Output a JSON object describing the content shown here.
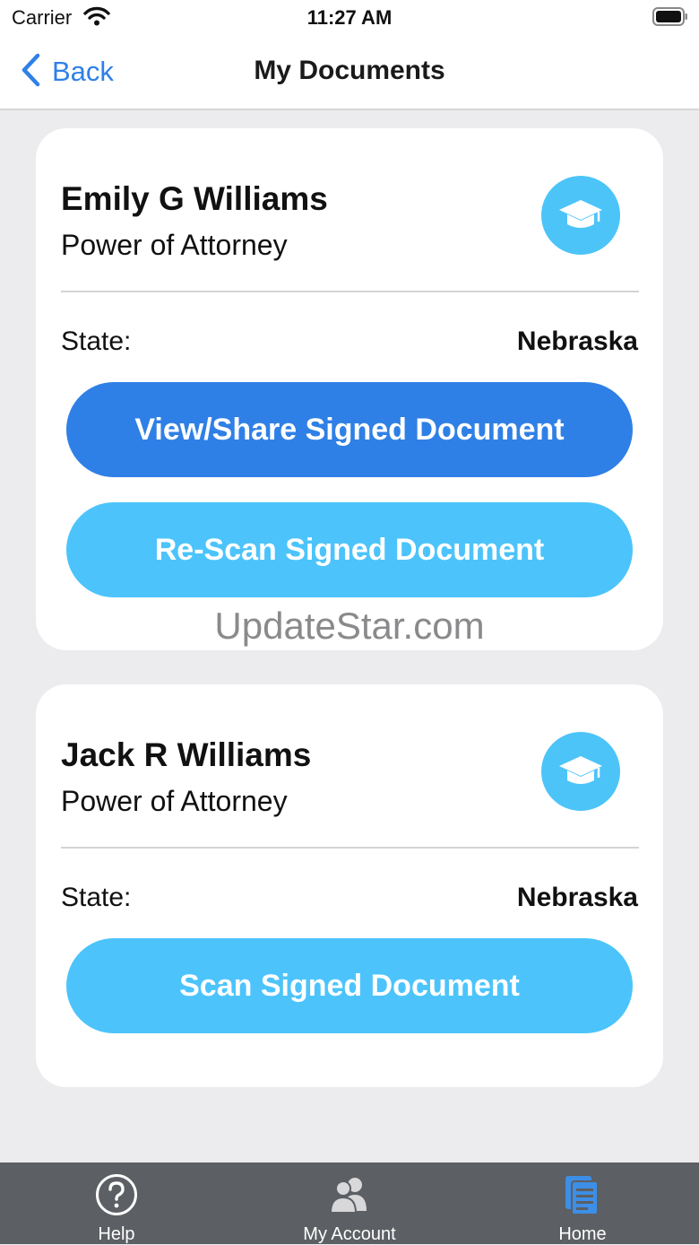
{
  "status_bar": {
    "carrier": "Carrier",
    "time": "11:27 AM"
  },
  "nav": {
    "back_label": "Back",
    "title": "My Documents"
  },
  "documents": [
    {
      "name": "Emily G Williams",
      "doc_type": "Power of Attorney",
      "state_label": "State:",
      "state_value": "Nebraska",
      "buttons": [
        "View/Share Signed Document",
        "Re-Scan Signed Document"
      ],
      "icon": "graduation-cap-icon"
    },
    {
      "name": "Jack R Williams",
      "doc_type": "Power of Attorney",
      "state_label": "State:",
      "state_value": "Nebraska",
      "buttons": [
        "Scan Signed Document"
      ],
      "icon": "graduation-cap-icon"
    }
  ],
  "watermark": "UpdateStar.com",
  "tabs": [
    {
      "label": "Help",
      "icon": "help-icon"
    },
    {
      "label": "My Account",
      "icon": "account-icon"
    },
    {
      "label": "Home",
      "icon": "documents-icon",
      "active": true
    }
  ],
  "colors": {
    "primary_blue": "#2f80e6",
    "light_blue": "#4cc4fb",
    "background": "#ececee",
    "tabbar": "#5c5f63",
    "active_tab_icon": "#3d8ee6"
  }
}
